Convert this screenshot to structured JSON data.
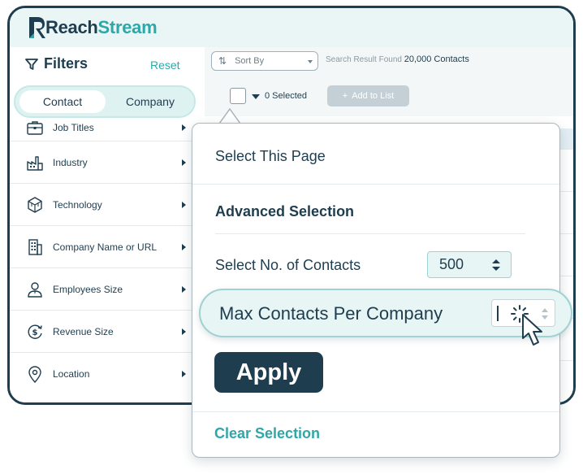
{
  "brand": {
    "name_part1": "Reach",
    "name_part2": "Stream"
  },
  "colors": {
    "primary": "#1e3d4f",
    "accent": "#2ea7a9",
    "light_teal": "#e8f5f5"
  },
  "sidebar": {
    "title": "Filters",
    "title_icon": "filter-icon",
    "reset_label": "Reset",
    "tabs": [
      {
        "label": "Contact",
        "active": true
      },
      {
        "label": "Company",
        "active": false
      }
    ],
    "items": [
      {
        "label": "Job Titles",
        "icon": "briefcase-icon"
      },
      {
        "label": "Industry",
        "icon": "factory-icon"
      },
      {
        "label": "Technology",
        "icon": "cube-icon"
      },
      {
        "label": "Company Name or URL",
        "icon": "building-icon"
      },
      {
        "label": "Employees Size",
        "icon": "person-icon"
      },
      {
        "label": "Revenue Size",
        "icon": "dollar-cycle-icon"
      },
      {
        "label": "Location",
        "icon": "location-pin-icon"
      }
    ]
  },
  "toolbar": {
    "sort_placeholder": "Sort By",
    "search_result_prefix": "Search Result Found",
    "search_result_count": "20,000 Contacts",
    "selected_label": "0 Selected",
    "add_to_list_label": "Add to List"
  },
  "popup": {
    "select_page_label": "Select This Page",
    "advanced_selection_label": "Advanced Selection",
    "num_contacts_label": "Select No. of Contacts",
    "num_contacts_value": "500",
    "max_per_company_label": "Max Contacts Per Company",
    "apply_label": "Apply",
    "clear_label": "Clear Selection"
  }
}
